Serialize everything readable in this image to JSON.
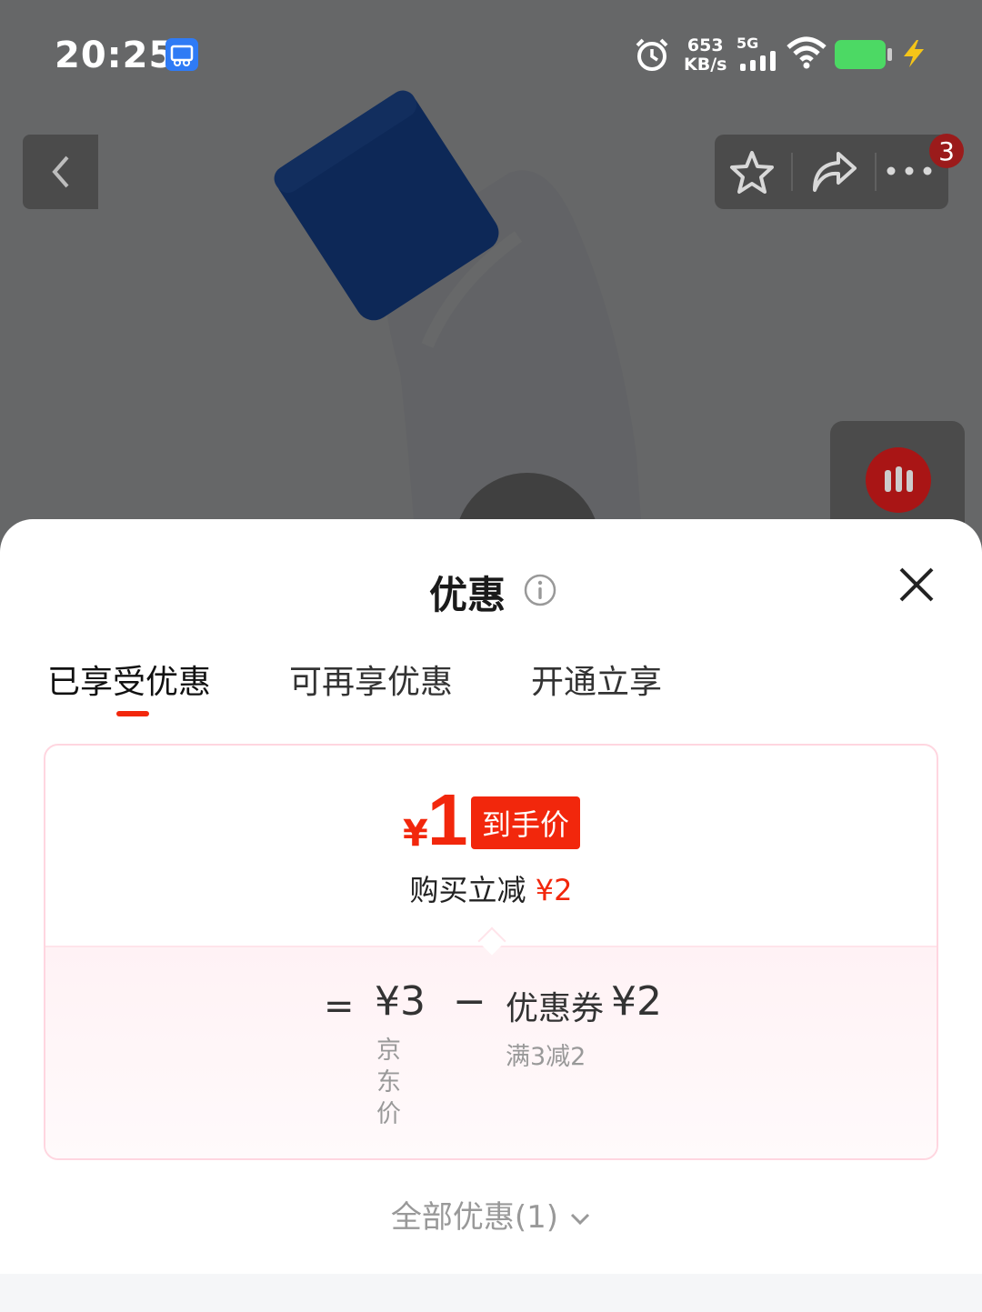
{
  "status_bar": {
    "time": "20:25",
    "net_speed_value": "653",
    "net_speed_unit": "KB/s",
    "net_type": "5G",
    "battery_color": "#4cd964"
  },
  "nav": {
    "badge_count": "3"
  },
  "sheet": {
    "title": "优惠",
    "tabs": [
      {
        "label": "已享受优惠"
      },
      {
        "label": "可再享优惠"
      },
      {
        "label": "开通立享"
      }
    ],
    "final_price": {
      "currency": "¥",
      "amount": "1",
      "tag": "到手价"
    },
    "reduce": {
      "label": "购买立减",
      "amount": "¥2"
    },
    "formula": {
      "equals": "=",
      "base_price": "¥3",
      "base_label": "京东价",
      "minus": "−",
      "coupon_label": "优惠券",
      "coupon_amount": "¥2",
      "coupon_rule": "满3减2"
    },
    "all_offers": "全部优惠(1)"
  },
  "colors": {
    "accent_red": "#f2270c",
    "card_border": "#ffd6e0"
  }
}
